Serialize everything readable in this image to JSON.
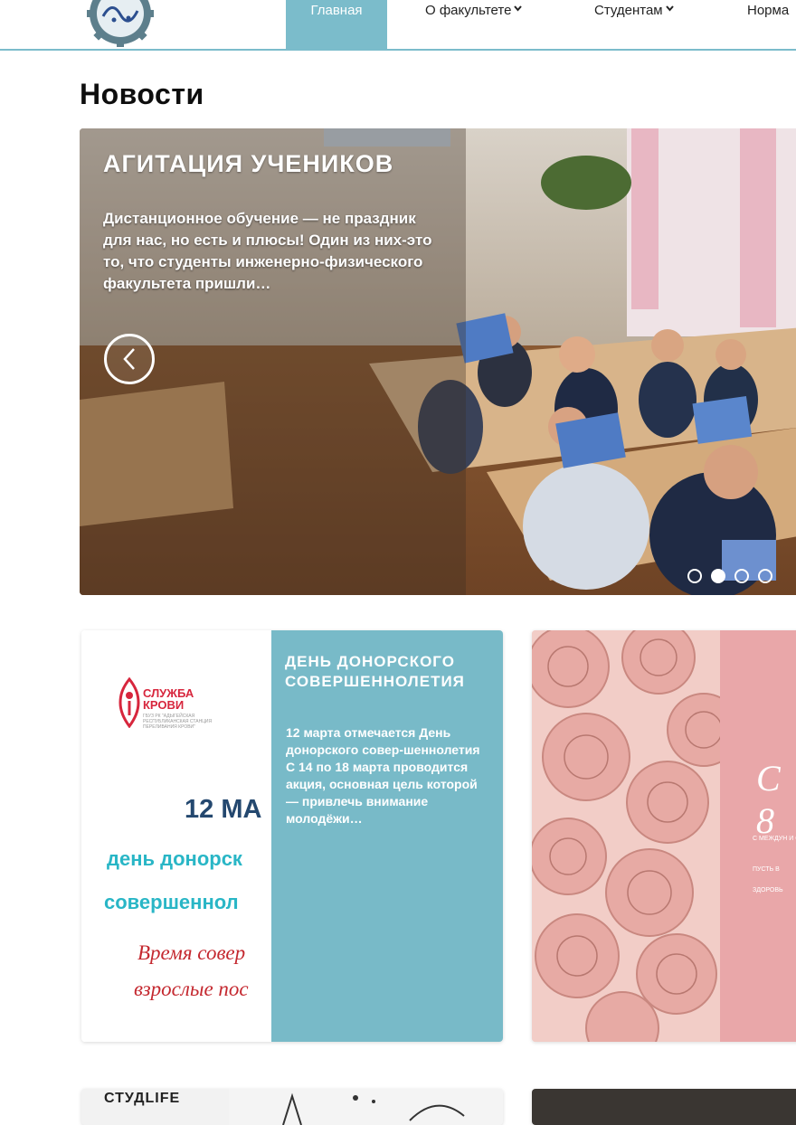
{
  "header": {
    "nav": [
      {
        "label": "Главная",
        "active": true
      },
      {
        "label": "О факультете",
        "has_dropdown": true
      },
      {
        "label": "Студентам",
        "has_dropdown": true
      },
      {
        "label": "Норма"
      }
    ],
    "accent_color": "#7bbccb"
  },
  "page_title": "Новости",
  "carousel": {
    "title": "АГИТАЦИЯ УЧЕНИКОВ",
    "text": "Дистанционное обучение — не праздник для нас, но есть и плюсы! Один из них-это то, что студенты инженерно-физического факультета пришли…",
    "slide_count": 4,
    "active_slide": 2,
    "icons": {
      "prev": "chevron-left-icon"
    }
  },
  "cards": [
    {
      "title": "ДЕНЬ ДОНОРСКОГО СОВЕРШЕННОЛЕТИЯ",
      "text": "12 марта отмечается День донорского совер-шеннолетия С 14 по 18 марта проводится акция, основная цель которой — привлечь внимание молодёжи…",
      "image": {
        "org_name": "СЛУЖБА КРОВИ",
        "org_sub": "ГБУЗ РК \"АДЫГЕЙСКАЯ РЕСПУБЛИКАНСКАЯ СТАНЦИЯ ПЕРЕЛИВАНИЯ КРОВИ\"",
        "date": "12 МА",
        "line1": "день донорск",
        "line2": "совершеннол",
        "line3": "Время совер",
        "line4": "взрослые пос"
      },
      "panel_color": "#78bac8"
    },
    {
      "image": {
        "script": "С 8",
        "tiny1": "С МЕЖДУН И С",
        "tiny2": "ПУСТЬ В",
        "tiny3": "ЗДОРОВЬ"
      },
      "panel_color": "#e9a7a9"
    },
    {
      "label": "СТУДLIFE"
    }
  ]
}
